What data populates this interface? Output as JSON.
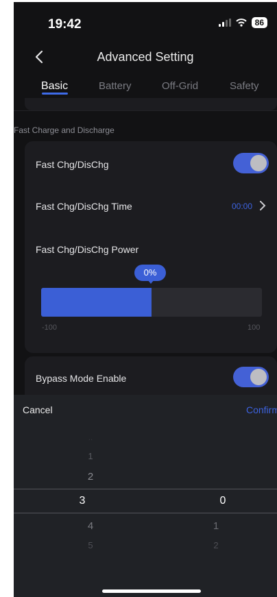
{
  "status": {
    "time": "19:42",
    "battery": "86"
  },
  "nav": {
    "title": "Advanced Setting"
  },
  "tabs": [
    {
      "label": "Basic",
      "active": true
    },
    {
      "label": "Battery",
      "active": false
    },
    {
      "label": "Off-Grid",
      "active": false
    },
    {
      "label": "Safety",
      "active": false
    }
  ],
  "section": {
    "label": "Fast Charge and Discharge"
  },
  "fast_card": {
    "toggle_label": "Fast Chg/DisChg",
    "toggle_on": true,
    "time_label": "Fast Chg/DisChg Time",
    "time_value": "00:00",
    "power_label": "Fast Chg/DisChg Power",
    "power_value": "0%",
    "slider_min": "-100",
    "slider_max": "100",
    "slider_fill_fraction": 0.5
  },
  "bypass": {
    "label": "Bypass Mode Enable",
    "toggle_on": true
  },
  "picker": {
    "cancel": "Cancel",
    "confirm": "Confirm",
    "left_column": [
      "1",
      "2",
      "3",
      "4",
      "5"
    ],
    "right_column": [
      "0",
      "1",
      "2"
    ],
    "left_selected": "3",
    "right_selected": "0"
  },
  "colors": {
    "accent": "#3b5fd6",
    "background": "#121214",
    "card": "#1c1c20"
  }
}
